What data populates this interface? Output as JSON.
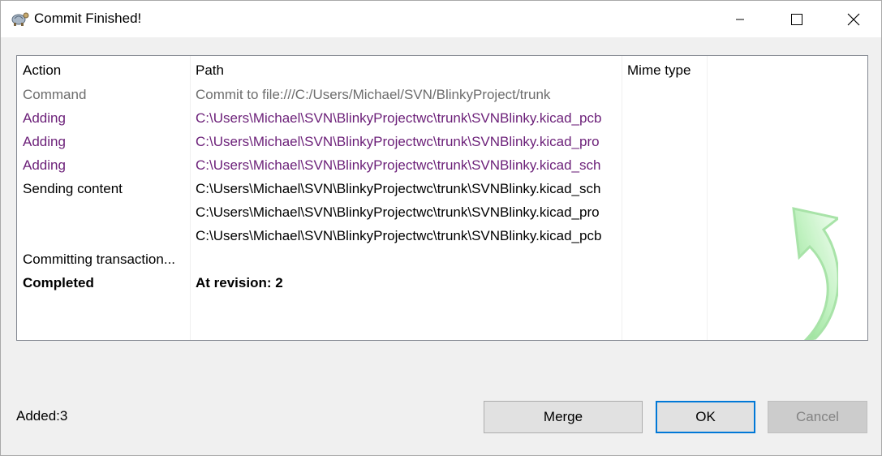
{
  "window": {
    "title": "Commit Finished!"
  },
  "grid": {
    "headers": {
      "action": "Action",
      "path": "Path",
      "mime": "Mime type"
    },
    "rows": [
      {
        "action": "Command",
        "path": "Commit to file:///C:/Users/Michael/SVN/BlinkyProject/trunk",
        "style": "gray"
      },
      {
        "action": "Adding",
        "path": "C:\\Users\\Michael\\SVN\\BlinkyProjectwc\\trunk\\SVNBlinky.kicad_pcb",
        "style": "purple"
      },
      {
        "action": "Adding",
        "path": "C:\\Users\\Michael\\SVN\\BlinkyProjectwc\\trunk\\SVNBlinky.kicad_pro",
        "style": "purple"
      },
      {
        "action": "Adding",
        "path": "C:\\Users\\Michael\\SVN\\BlinkyProjectwc\\trunk\\SVNBlinky.kicad_sch",
        "style": "purple"
      },
      {
        "action": "Sending content",
        "path": "C:\\Users\\Michael\\SVN\\BlinkyProjectwc\\trunk\\SVNBlinky.kicad_sch",
        "style": "black"
      },
      {
        "action": "",
        "path": "C:\\Users\\Michael\\SVN\\BlinkyProjectwc\\trunk\\SVNBlinky.kicad_pro",
        "style": "black"
      },
      {
        "action": "",
        "path": "C:\\Users\\Michael\\SVN\\BlinkyProjectwc\\trunk\\SVNBlinky.kicad_pcb",
        "style": "black"
      },
      {
        "action": "Committing transaction...",
        "path": "",
        "style": "black"
      },
      {
        "action": "Completed",
        "path": "At revision: 2",
        "style": "bold"
      }
    ]
  },
  "status": {
    "text": "Added:3"
  },
  "buttons": {
    "merge": "Merge",
    "ok": "OK",
    "cancel": "Cancel"
  },
  "colors": {
    "gray": "#6d6d6d",
    "purple": "#6b1f78",
    "focus": "#0078d7",
    "arrow_green": "#8fe28f"
  },
  "icons": {
    "app": "tortoise-icon",
    "decor": "green-arrow-icon"
  }
}
